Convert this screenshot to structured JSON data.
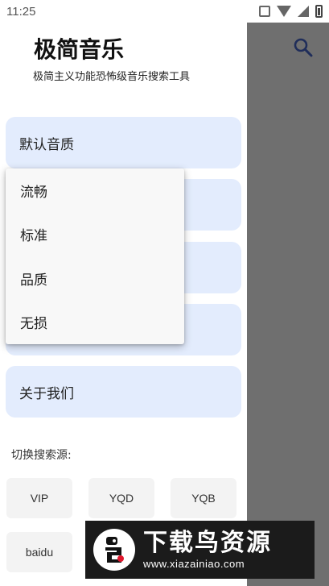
{
  "status_bar": {
    "time": "11:25",
    "icons": [
      "vibrate-icon",
      "wifi-icon",
      "signal-icon",
      "battery-icon"
    ]
  },
  "drawer": {
    "app_title": "极简音乐",
    "app_subtitle": "极简主义功能恐怖级音乐搜索工具",
    "menu": [
      {
        "label": "默认音质"
      },
      {
        "label": ""
      },
      {
        "label": ""
      },
      {
        "label": ""
      },
      {
        "label": "关于我们"
      }
    ],
    "source_label": "切换搜索源:",
    "sources": [
      "VIP",
      "YQD",
      "YQB",
      "baidu"
    ]
  },
  "dropdown": {
    "options": [
      "流畅",
      "标准",
      "品质",
      "无损"
    ]
  },
  "toolbar": {
    "search_icon": "search-icon"
  },
  "watermark": {
    "main_text": "下载鸟资源",
    "url": "www.xiazainiao.com"
  },
  "colors": {
    "card_bg": "#e3ecfd",
    "overlay": "#6f6f6f",
    "source_btn_bg": "#f3f3f3",
    "search_icon": "#1f2d5a"
  }
}
